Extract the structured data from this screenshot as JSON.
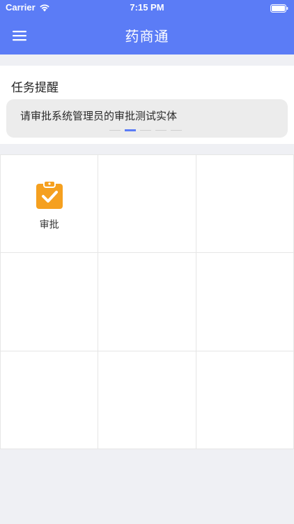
{
  "status_bar": {
    "carrier": "Carrier",
    "time": "7:15 PM"
  },
  "nav": {
    "title": "药商通",
    "menu_icon": "hamburger-menu-icon"
  },
  "task_reminder": {
    "section_title": "任务提醒",
    "message": "请审批系统管理员的审批测试实体",
    "page_count": 5,
    "active_page": 2
  },
  "grid": {
    "items": [
      {
        "label": "审批",
        "icon": "clipboard-check-icon",
        "color": "#f5a01f"
      }
    ]
  },
  "colors": {
    "header": "#5b7cf6",
    "background": "#eff0f4",
    "accent": "#5b7cf6",
    "icon_orange": "#f5a01f"
  }
}
